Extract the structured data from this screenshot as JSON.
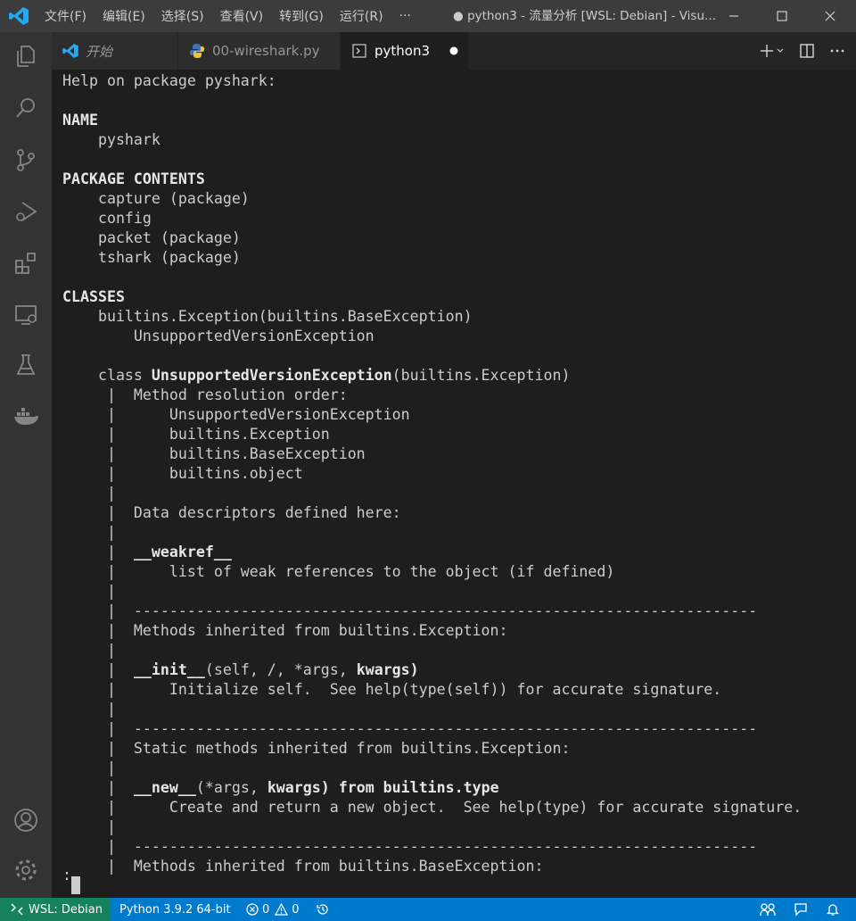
{
  "menu": [
    "文件(F)",
    "编辑(E)",
    "选择(S)",
    "查看(V)",
    "转到(G)",
    "运行(R)",
    "···"
  ],
  "window": {
    "title": "● python3 - 流量分析 [WSL: Debian] - Visu..."
  },
  "tabs": [
    {
      "label": "开始",
      "icon": "vscode-icon"
    },
    {
      "label": "00-wireshark.py",
      "icon": "python-icon"
    },
    {
      "label": "python3",
      "icon": "terminal-icon",
      "modified": true
    }
  ],
  "activity_icons": [
    "explorer-icon",
    "search-icon",
    "source-control-icon",
    "run-debug-icon",
    "extensions-icon",
    "remote-explorer-icon",
    "testing-icon",
    "docker-icon",
    "account-icon",
    "settings-gear-icon"
  ],
  "terminal": {
    "lines": [
      "Help on package pyshark:",
      "",
      "**NAME**",
      "    pyshark",
      "",
      "**PACKAGE CONTENTS**",
      "    capture (package)",
      "    config",
      "    packet (package)",
      "    tshark (package)",
      "",
      "**CLASSES**",
      "    builtins.Exception(builtins.BaseException)",
      "        UnsupportedVersionException",
      "",
      "    class **UnsupportedVersionException**(builtins.Exception)",
      "     |  Method resolution order:",
      "     |      UnsupportedVersionException",
      "     |      builtins.Exception",
      "     |      builtins.BaseException",
      "     |      builtins.object",
      "     |",
      "     |  Data descriptors defined here:",
      "     |",
      "     |  **__weakref__**",
      "     |      list of weak references to the object (if defined)",
      "     |",
      "     |  ----------------------------------------------------------------------",
      "     |  Methods inherited from builtins.Exception:",
      "     |",
      "     |  **__init__**(self, /, *args, **kwargs)",
      "     |      Initialize self.  See help(type(self)) for accurate signature.",
      "     |",
      "     |  ----------------------------------------------------------------------",
      "     |  Static methods inherited from builtins.Exception:",
      "     |",
      "     |  **__new__**(*args, **kwargs) from builtins.type",
      "     |      Create and return a new object.  See help(type) for accurate signature.",
      "     |",
      "     |  ----------------------------------------------------------------------",
      "     |  Methods inherited from builtins.BaseException:"
    ],
    "prompt": ":"
  },
  "statusbar": {
    "remote": "WSL: Debian",
    "python": "Python 3.9.2 64-bit",
    "errors": "0",
    "warnings": "0"
  },
  "colors": {
    "titlebar": "#3c3c3c",
    "activitybar": "#333333",
    "editor_bg": "#1e1e1e",
    "statusbar": "#007acc",
    "remote": "#16825d",
    "vscode_blue": "#23a9f2"
  }
}
